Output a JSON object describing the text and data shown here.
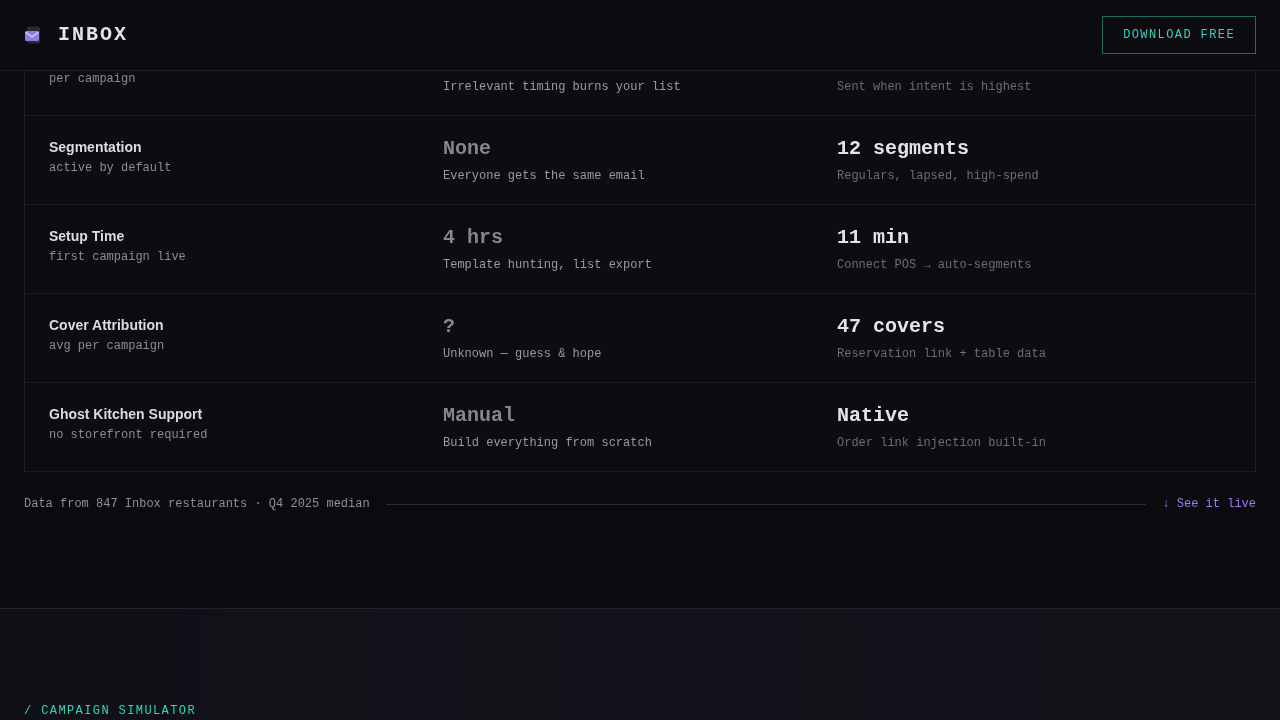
{
  "header": {
    "brand": "INBOX",
    "button": "DOWNLOAD FREE"
  },
  "comparison": {
    "rows": [
      {
        "sublabel": "per campaign",
        "before": {
          "note": "Irrelevant timing burns your list"
        },
        "after": {
          "note": "Sent when intent is highest"
        }
      },
      {
        "label": "Segmentation",
        "sublabel": "active by default",
        "before": {
          "value": "None",
          "note": "Everyone gets the same email"
        },
        "after": {
          "value": "12 segments",
          "note": "Regulars, lapsed, high-spend"
        }
      },
      {
        "label": "Setup Time",
        "sublabel": "first campaign live",
        "before": {
          "value": "4 hrs",
          "note": "Template hunting, list export"
        },
        "after": {
          "value": "11 min",
          "note": "Connect POS → auto-segments"
        }
      },
      {
        "label": "Cover Attribution",
        "sublabel": "avg per campaign",
        "before": {
          "value": "?",
          "note": "Unknown — guess & hope"
        },
        "after": {
          "value": "47 covers",
          "note": "Reservation link + table data"
        }
      },
      {
        "label": "Ghost Kitchen Support",
        "sublabel": "no storefront required",
        "before": {
          "value": "Manual",
          "note": "Build everything from scratch"
        },
        "after": {
          "value": "Native",
          "note": "Order link injection built-in"
        }
      }
    ]
  },
  "footnote": {
    "text": "Data from 847 Inbox restaurants · Q4 2025 median",
    "link": "↓ See it live"
  },
  "next_section": {
    "label": "/ CAMPAIGN SIMULATOR"
  }
}
